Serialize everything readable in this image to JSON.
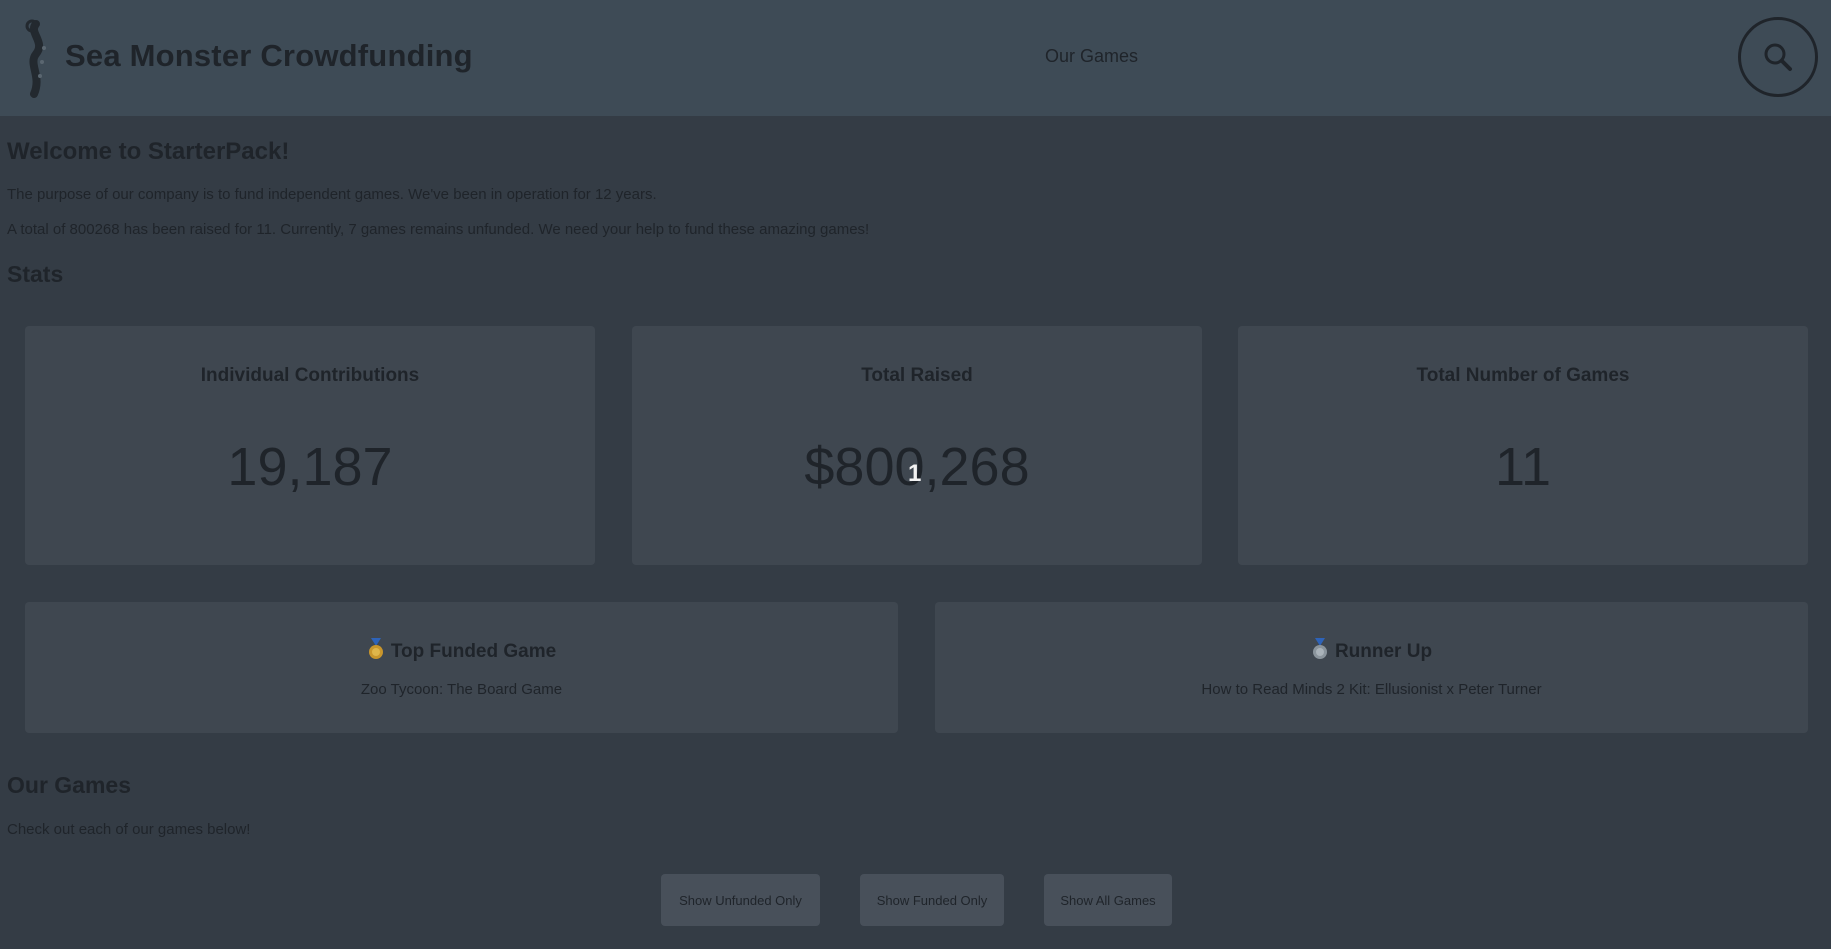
{
  "header": {
    "brand": "Sea Monster Crowdfunding",
    "nav_link": "Our Games",
    "logo_icon": "sea-monster-tentacle-icon",
    "search_icon": "search-icon"
  },
  "welcome": {
    "title": "Welcome to StarterPack!",
    "intro": "The purpose of our company is to fund independent games. We've been in operation for 12 years.",
    "summary": "A total of 800268 has been raised for 11. Currently, 7 games remains unfunded. We need your help to fund these amazing games!"
  },
  "stats": {
    "title": "Stats",
    "cards": [
      {
        "label": "Individual Contributions",
        "value": "19,187"
      },
      {
        "label": "Total Raised",
        "value": "$800,268"
      },
      {
        "label": "Total Number of Games",
        "value": "11"
      }
    ],
    "cursor_mark": "1"
  },
  "highlights": {
    "top": {
      "icon": "gold-medal-icon",
      "title": "Top Funded Game",
      "game": "Zoo Tycoon: The Board Game"
    },
    "runner": {
      "icon": "silver-medal-icon",
      "title": "Runner Up",
      "game": "How to Read Minds 2 Kit: Ellusionist x Peter Turner"
    }
  },
  "games": {
    "title": "Our Games",
    "subtitle": "Check out each of our games below!",
    "buttons": {
      "unfunded": "Show Unfunded Only",
      "funded": "Show Funded Only",
      "all": "Show All Games"
    }
  },
  "colors": {
    "background": "#343c45",
    "header": "#3e4b56",
    "card": "#3f4750",
    "button": "#48505a",
    "text": "#1f242a"
  }
}
